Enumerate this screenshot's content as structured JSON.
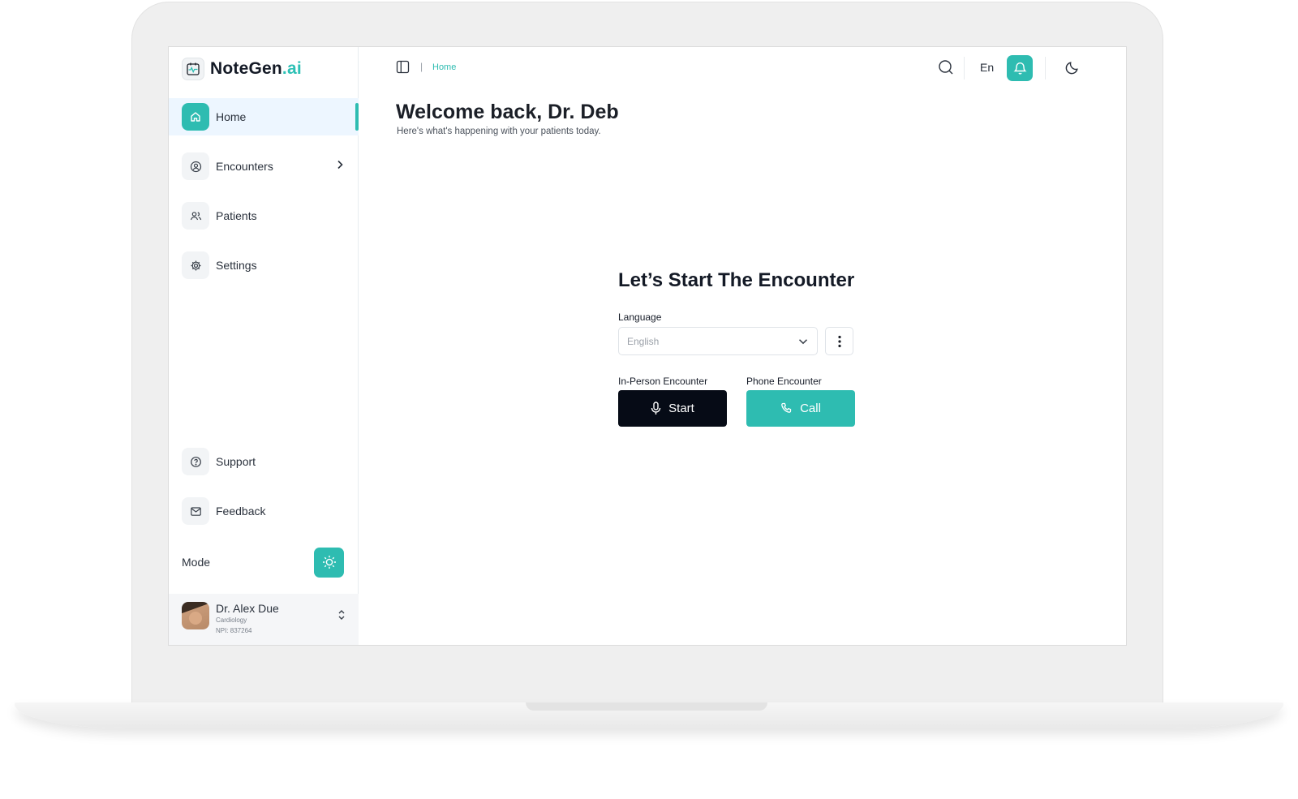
{
  "brand": {
    "name": "NoteGen",
    "suffix": ".ai",
    "accent_color": "#2ebcb1"
  },
  "sidebar": {
    "items": [
      {
        "label": "Home",
        "icon": "home-icon",
        "active": true
      },
      {
        "label": "Encounters",
        "icon": "user-circle-icon",
        "has_submenu": true
      },
      {
        "label": "Patients",
        "icon": "users-icon"
      },
      {
        "label": "Settings",
        "icon": "gear-icon"
      }
    ],
    "bottom_items": [
      {
        "label": "Support",
        "icon": "help-circle-icon"
      },
      {
        "label": "Feedback",
        "icon": "mail-icon"
      }
    ],
    "mode_label": "Mode",
    "mode_icon": "sun-icon"
  },
  "user": {
    "name": "Dr. Alex Due",
    "specialty": "Cardiology",
    "npi": "NPI: 837264"
  },
  "topbar": {
    "breadcrumb_separator": "|",
    "breadcrumb": "Home",
    "language": "En"
  },
  "main": {
    "welcome_prefix": "Welcome back, ",
    "welcome_name": "Dr. Deb",
    "welcome_sub": "Here's what's happening with your patients today.",
    "card_title": "Let’s Start The Encounter",
    "language_label": "Language",
    "language_value": "English",
    "in_person_label": "In-Person Encounter",
    "phone_label": "Phone Encounter",
    "start_label": "Start",
    "call_label": "Call"
  }
}
